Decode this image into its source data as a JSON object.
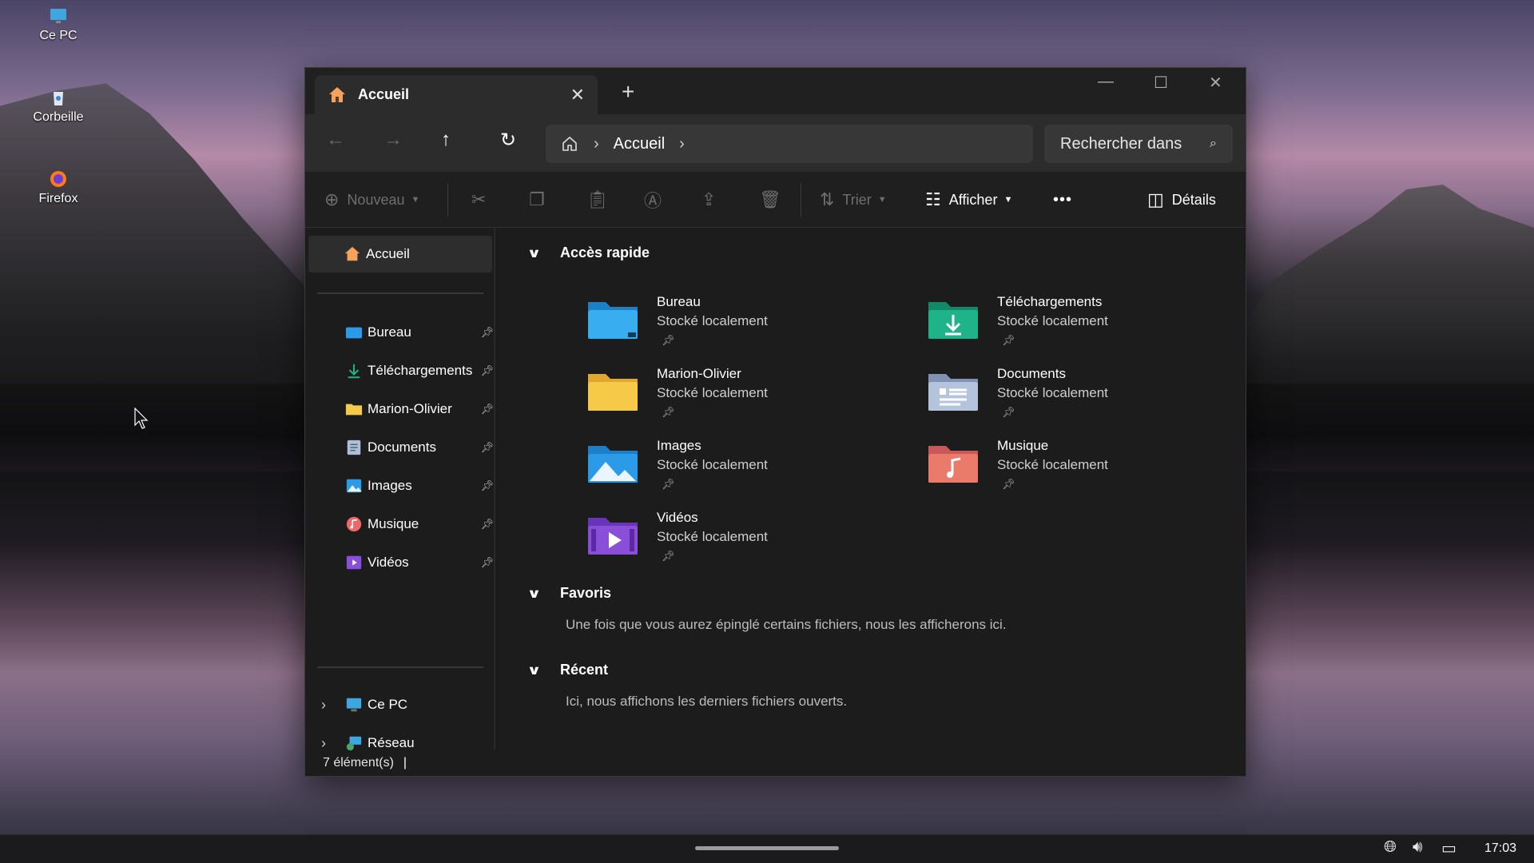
{
  "desktop": {
    "icons": [
      {
        "label": "Ce PC",
        "icon": "monitor-icon"
      },
      {
        "label": "Corbeille",
        "icon": "recycle-bin-icon"
      },
      {
        "label": "Firefox",
        "icon": "firefox-icon"
      }
    ]
  },
  "window": {
    "tab_title": "Accueil",
    "breadcrumb": {
      "current": "Accueil"
    },
    "search_placeholder": "Rechercher dans",
    "toolbar": {
      "new_label": "Nouveau",
      "sort_label": "Trier",
      "view_label": "Afficher",
      "more_label": "•••",
      "details_label": "Détails"
    },
    "sidebar": {
      "home": "Accueil",
      "items": [
        {
          "label": "Bureau",
          "icon": "desktop-folder-icon"
        },
        {
          "label": "Téléchargements",
          "icon": "download-icon"
        },
        {
          "label": "Marion-Olivier",
          "icon": "folder-icon"
        },
        {
          "label": "Documents",
          "icon": "documents-icon"
        },
        {
          "label": "Images",
          "icon": "images-icon"
        },
        {
          "label": "Musique",
          "icon": "music-icon"
        },
        {
          "label": "Vidéos",
          "icon": "videos-icon"
        }
      ],
      "locations": [
        {
          "label": "Ce PC",
          "icon": "monitor-icon"
        },
        {
          "label": "Réseau",
          "icon": "network-icon"
        }
      ]
    },
    "sections": {
      "quick_access": {
        "title": "Accès rapide",
        "items": [
          {
            "name": "Bureau",
            "sub": "Stocké localement"
          },
          {
            "name": "Téléchargements",
            "sub": "Stocké localement"
          },
          {
            "name": "Marion-Olivier",
            "sub": "Stocké localement"
          },
          {
            "name": "Documents",
            "sub": "Stocké localement"
          },
          {
            "name": "Images",
            "sub": "Stocké localement"
          },
          {
            "name": "Musique",
            "sub": "Stocké localement"
          },
          {
            "name": "Vidéos",
            "sub": "Stocké localement"
          }
        ]
      },
      "favorites": {
        "title": "Favoris",
        "message": "Une fois que vous aurez épinglé certains fichiers, nous les afficherons ici."
      },
      "recent": {
        "title": "Récent",
        "message": "Ici, nous affichons les derniers fichiers ouverts."
      }
    },
    "status": "7 élément(s)"
  },
  "taskbar": {
    "clock": "17:03"
  },
  "colors": {
    "accent_folder": "#f7c948",
    "accent_blue": "#2b9be8",
    "accent_green": "#1fb38a"
  }
}
